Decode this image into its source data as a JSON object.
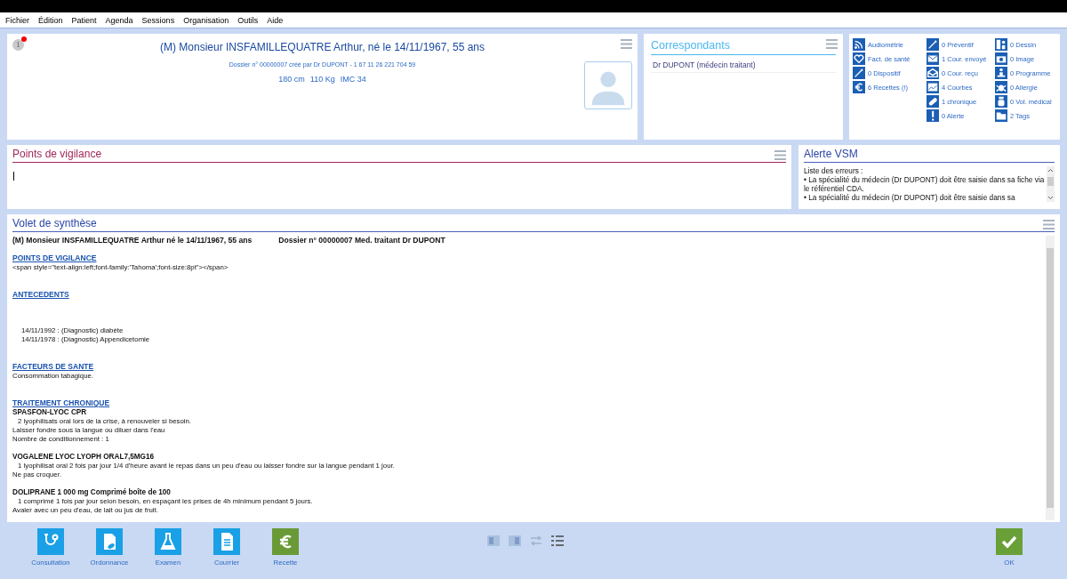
{
  "menu": [
    "Fichier",
    "Édition",
    "Patient",
    "Agenda",
    "Sessions",
    "Organisation",
    "Outils",
    "Aide"
  ],
  "patient": {
    "badge": "1",
    "name": "(M) Monsieur INSFAMILLEQUATRE Arthur, né le 14/11/1967, 55 ans",
    "dossier": "Dossier n° 00000007 créé par Dr DUPONT - 1 67 11 26 221 704 59",
    "measures": [
      "180 cm",
      "110 Kg",
      "IMC 34"
    ]
  },
  "correspondants": {
    "title": "Correspondants",
    "items": [
      "Dr DUPONT (médecin traitant)"
    ]
  },
  "stats": {
    "columns": [
      [
        "Audiométrie",
        "Fact. de santé",
        "0 Dispositif",
        "6 Recettes (!)"
      ],
      [
        "0 Préventif",
        "1 Cour. envoyé",
        "0 Cour. reçu",
        "4 Courbes",
        "1 chronique",
        "0 Alerte"
      ],
      [
        "0 Dessin",
        "0 Image",
        "0 Programme",
        "0 Allergie",
        "0 Vol. médical",
        "2 Tags"
      ]
    ]
  },
  "vigilance": {
    "title": "Points de vigilance"
  },
  "alerte": {
    "title": "Alerte VSM",
    "lines": [
      "Liste des erreurs :",
      "• La spécialité du médecin (Dr DUPONT) doit être saisie dans sa fiche via le référentiel CDA.",
      "• La spécialité du médecin (Dr DUPONT) doit être saisie dans sa"
    ]
  },
  "synthese": {
    "title": "Volet de synthèse",
    "header": [
      "(M) Monsieur INSFAMILLEQUATRE Arthur né le 14/11/1967, 55 ans",
      "Dossier n° 00000007 Med. traitant Dr DUPONT"
    ],
    "sections": [
      {
        "heading": "POINTS DE VIGILANCE",
        "blocks": [
          [
            {
              "kind": "plain",
              "text": "<span style=\"text-align:left;font-family:'Tahoma';font-size:8pt\"></span>"
            }
          ]
        ]
      },
      {
        "heading": "ANTECEDENTS",
        "blocks": [
          [
            {
              "kind": "item",
              "text": "14/11/1992 : (Diagnostic) diabète"
            },
            {
              "kind": "item",
              "text": "14/11/1978 : (Diagnostic) Appendicetomie"
            }
          ]
        ]
      },
      {
        "heading": "FACTEURS DE SANTE",
        "blocks": [
          [
            {
              "kind": "plain",
              "text": "Consommation tabagique."
            }
          ]
        ]
      },
      {
        "heading": "TRAITEMENT CHRONIQUE",
        "blocks": [
          [
            {
              "kind": "bold",
              "text": "SPASFON-LYOC CPR"
            },
            {
              "kind": "indent",
              "text": "2 lyophilisats oral lors de la crise, à renouveler si besoin."
            },
            {
              "kind": "plain",
              "text": "Laisser fondre sous la langue ou diluer dans l'eau"
            },
            {
              "kind": "plain",
              "text": "Nombre de conditionnement : 1"
            }
          ],
          [
            {
              "kind": "bold",
              "text": "VOGALENE LYOC LYOPH ORAL7,5MG16"
            },
            {
              "kind": "indent",
              "text": "1 lyophilisat oral 2 fois par jour 1/4 d'heure avant le repas dans un peu d'eau ou laisser fondre sur la langue pendant 1 jour."
            },
            {
              "kind": "plain",
              "text": "Ne pas croquer."
            }
          ],
          [
            {
              "kind": "bold",
              "text": "DOLIPRANE 1 000 mg Comprimé boîte de 100"
            },
            {
              "kind": "indent",
              "text": "1 comprimé 1 fois par jour selon besoin, en espaçant les prises de 4h minimum pendant 5 jours."
            },
            {
              "kind": "plain",
              "text": "Avaler avec un peu d'eau, de lait ou jus de fruit."
            }
          ]
        ]
      }
    ]
  },
  "toolbar": [
    {
      "label": "Consultation",
      "kind": "blue"
    },
    {
      "label": "Ordonnance",
      "kind": "blue"
    },
    {
      "label": "Examen",
      "kind": "blue"
    },
    {
      "label": "Courrier",
      "kind": "blue"
    },
    {
      "label": "Recette",
      "kind": "green"
    }
  ],
  "ok": {
    "label": "OK"
  }
}
